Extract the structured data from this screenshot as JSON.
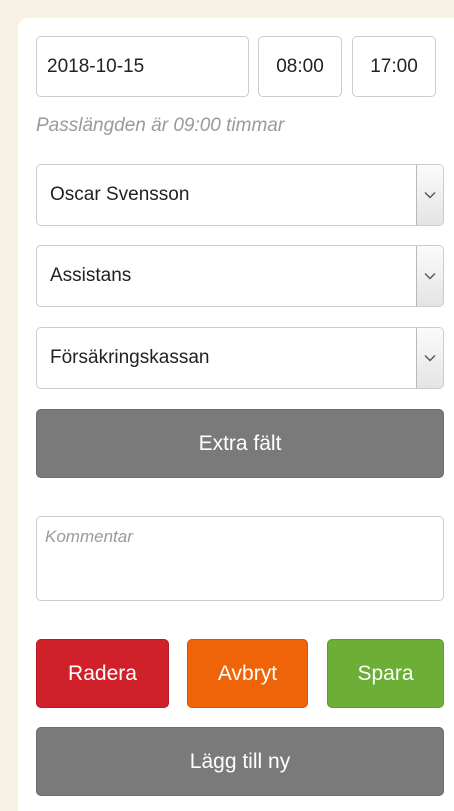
{
  "shift": {
    "date": "2018-10-15",
    "start_time": "08:00",
    "end_time": "17:00",
    "length_hint": "Passlängden är 09:00 timmar"
  },
  "selects": {
    "person": "Oscar Svensson",
    "type": "Assistans",
    "payer": "Försäkringskassan"
  },
  "buttons": {
    "extra_fields": "Extra fält",
    "delete": "Radera",
    "cancel": "Avbryt",
    "save": "Spara",
    "add_new": "Lägg till ny"
  },
  "comment": {
    "placeholder": "Kommentar"
  },
  "colors": {
    "background": "#f7f2e4",
    "gray_button": "#7a7a7a",
    "delete": "#d0212b",
    "cancel": "#f06409",
    "save": "#6cae36"
  }
}
